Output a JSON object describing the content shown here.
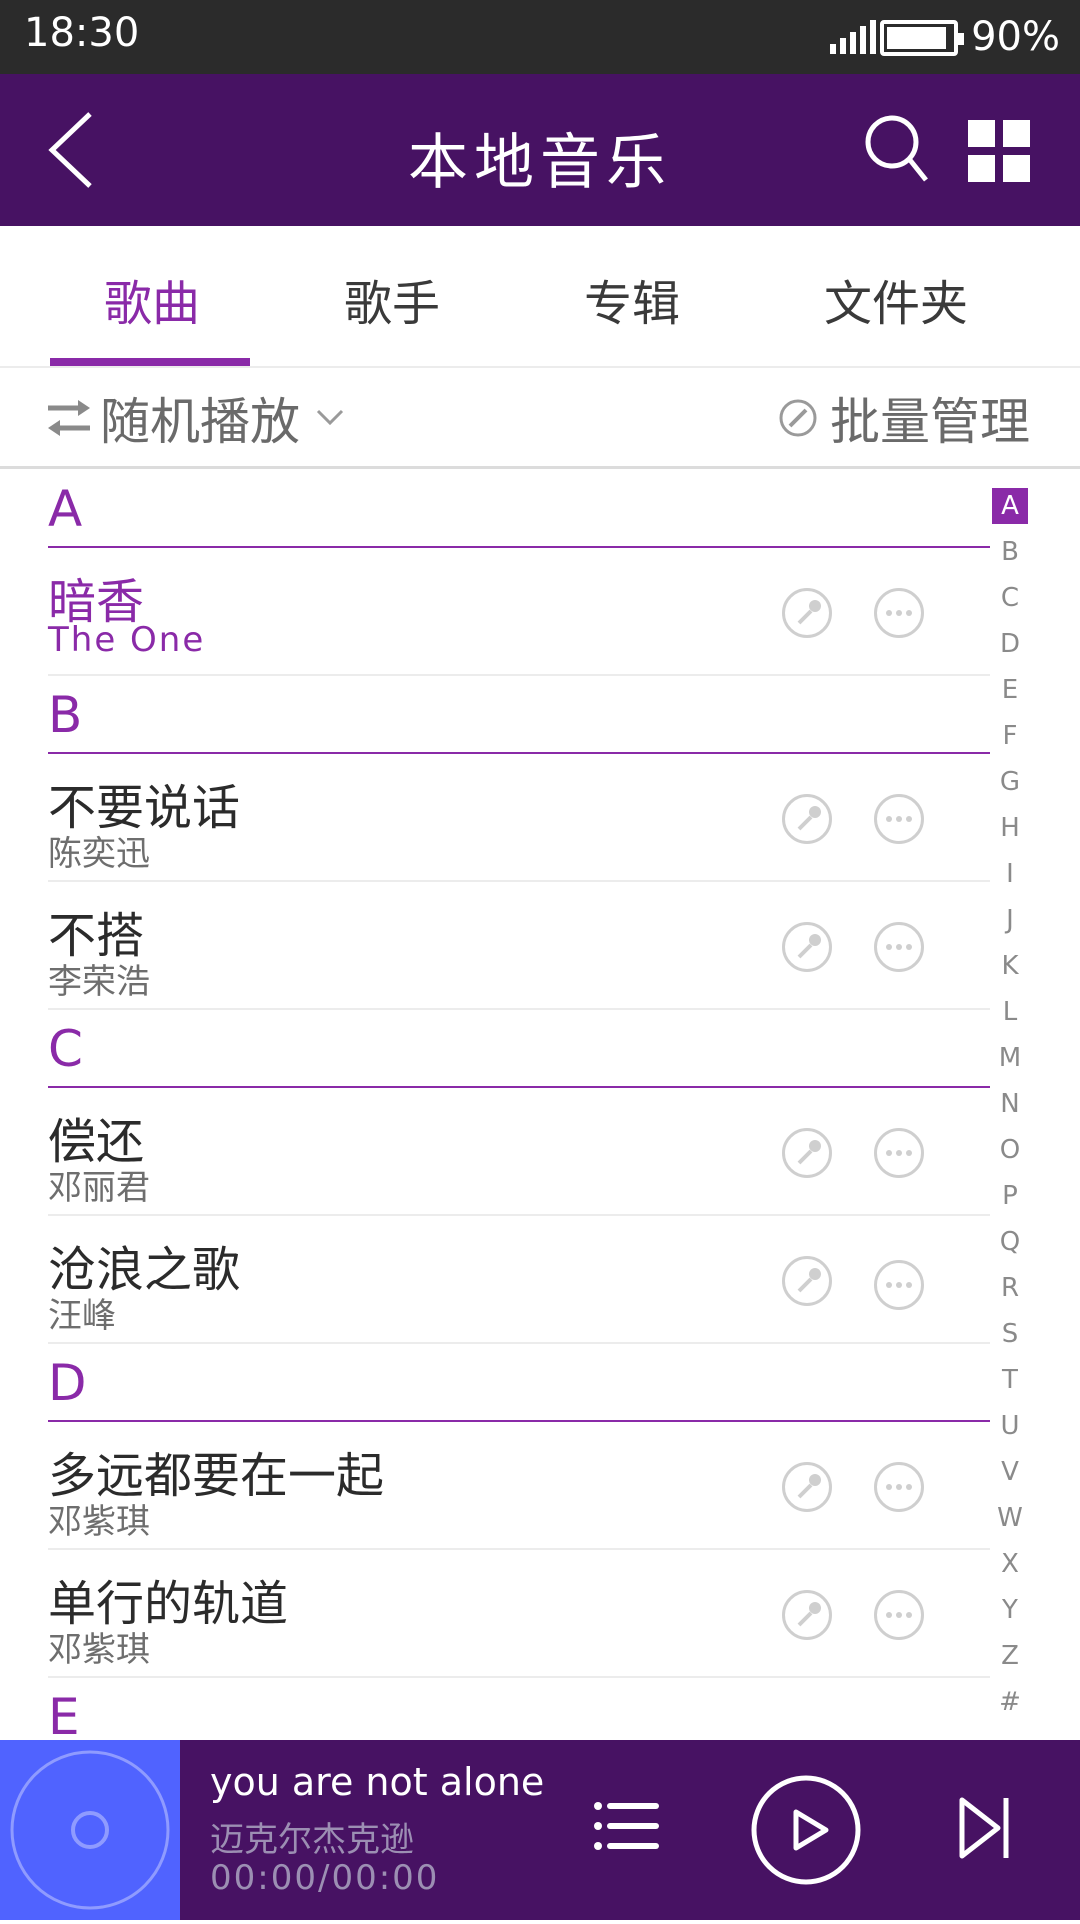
{
  "status": {
    "time": "18:30",
    "battery": "90%"
  },
  "header": {
    "title": "本地音乐"
  },
  "tabs": [
    {
      "label": "歌曲",
      "active": true
    },
    {
      "label": "歌手"
    },
    {
      "label": "专辑"
    },
    {
      "label": "文件夹"
    }
  ],
  "toolbar": {
    "play_mode": "随机播放",
    "batch": "批量管理"
  },
  "sections": [
    {
      "letter": "A",
      "songs": [
        {
          "title": "暗香",
          "artist": "The One",
          "highlighted": true
        }
      ]
    },
    {
      "letter": "B",
      "songs": [
        {
          "title": "不要说话",
          "artist": "陈奕迅"
        },
        {
          "title": "不搭",
          "artist": "李荣浩"
        }
      ]
    },
    {
      "letter": "C",
      "songs": [
        {
          "title": "偿还",
          "artist": "邓丽君"
        },
        {
          "title": "沧浪之歌",
          "artist": "汪峰"
        }
      ]
    },
    {
      "letter": "D",
      "songs": [
        {
          "title": "多远都要在一起",
          "artist": "邓紫琪"
        },
        {
          "title": "单行的轨道",
          "artist": "邓紫琪"
        }
      ]
    },
    {
      "letter": "E",
      "songs": []
    }
  ],
  "index": {
    "letters": [
      "A",
      "B",
      "C",
      "D",
      "E",
      "F",
      "G",
      "H",
      "I",
      "J",
      "K",
      "L",
      "M",
      "N",
      "O",
      "P",
      "Q",
      "R",
      "S",
      "T",
      "U",
      "V",
      "W",
      "X",
      "Y",
      "Z",
      "#"
    ],
    "active": "A"
  },
  "player": {
    "title": "you are not alone",
    "artist": "迈克尔杰克逊",
    "time": "00:00/00:00"
  },
  "colors": {
    "primary": "#471263",
    "accent": "#8a2aa8",
    "album_art": "#5063ff"
  }
}
